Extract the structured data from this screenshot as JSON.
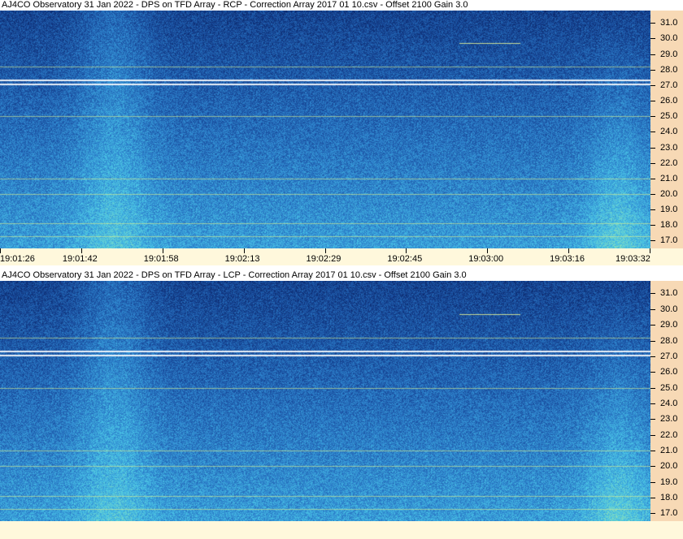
{
  "chart_data": [
    {
      "type": "heatmap",
      "title": "AJ4CO Observatory 31 Jan 2022  -  DPS on TFD Array  -  RCP  -  Correction Array 2017 01 10.csv  -  Offset 2100  Gain 3.0",
      "ylabel": "",
      "xlabel": "",
      "y_ticks": [
        "31.0",
        "30.0",
        "29.0",
        "28.0",
        "27.0",
        "26.0",
        "25.0",
        "24.0",
        "23.0",
        "22.0",
        "21.0",
        "20.0",
        "19.0",
        "18.0",
        "17.0"
      ],
      "y_range": [
        16.5,
        31.8
      ],
      "x_ticks": [
        "19:01:26",
        "19:01:42",
        "19:01:58",
        "19:02:13",
        "19:02:29",
        "19:02:45",
        "19:03:00",
        "19:03:16",
        "19:03:32"
      ],
      "colormap": [
        "#0a2466",
        "#1a4fa0",
        "#2f86cf",
        "#49c3e6",
        "#8be0b8",
        "#d8f06a",
        "#ffffff"
      ]
    },
    {
      "type": "heatmap",
      "title": "AJ4CO Observatory 31 Jan 2022  -  DPS on TFD Array  -  LCP  -  Correction Array 2017 01 10.csv  -  Offset 2100  Gain 3.0",
      "ylabel": "",
      "xlabel": "",
      "y_ticks": [
        "31.0",
        "30.0",
        "29.0",
        "28.0",
        "27.0",
        "26.0",
        "25.0",
        "24.0",
        "23.0",
        "22.0",
        "21.0",
        "20.0",
        "19.0",
        "18.0",
        "17.0"
      ],
      "y_range": [
        16.5,
        31.8
      ],
      "x_ticks": [],
      "colormap": [
        "#0a2466",
        "#1a4fa0",
        "#2f86cf",
        "#49c3e6",
        "#8be0b8",
        "#d8f06a",
        "#ffffff"
      ]
    }
  ]
}
